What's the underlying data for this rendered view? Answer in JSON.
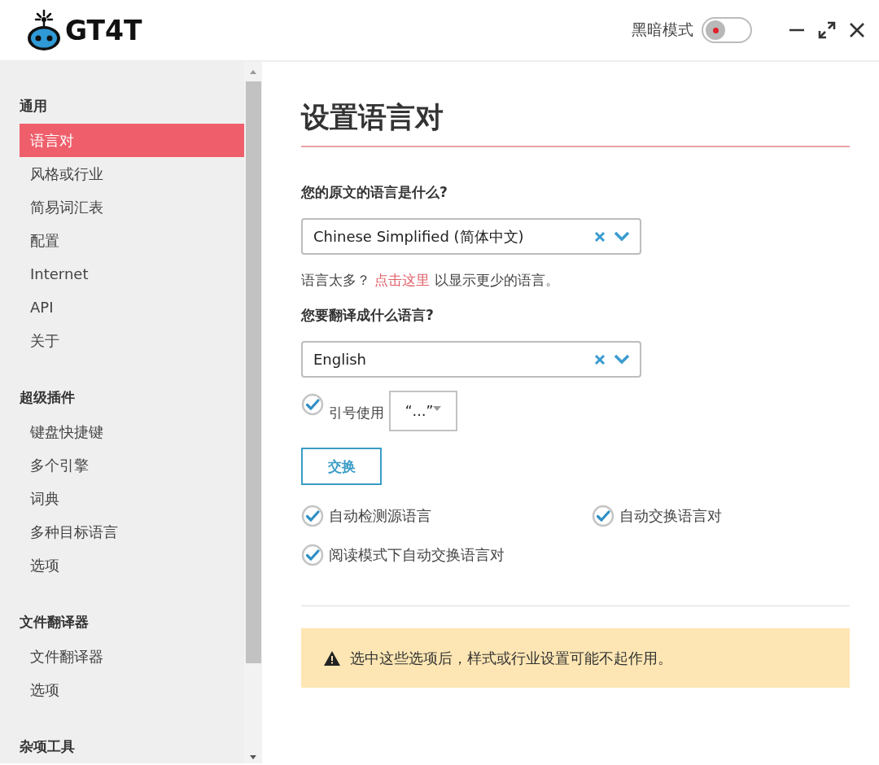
{
  "header": {
    "logo_text": "GT4T",
    "dark_mode": {
      "label": "黑暗模式",
      "on": false
    }
  },
  "sidebar": {
    "groups": [
      {
        "heading": "通用",
        "items": [
          {
            "label": "语言对",
            "selected": true
          },
          {
            "label": "风格或行业",
            "selected": false
          },
          {
            "label": "简易词汇表",
            "selected": false
          },
          {
            "label": "配置",
            "selected": false
          },
          {
            "label": "Internet",
            "selected": false
          },
          {
            "label": "API",
            "selected": false
          },
          {
            "label": "关于",
            "selected": false
          }
        ]
      },
      {
        "heading": "超级插件",
        "items": [
          {
            "label": "键盘快捷键",
            "selected": false
          },
          {
            "label": "多个引擎",
            "selected": false
          },
          {
            "label": "词典",
            "selected": false
          },
          {
            "label": "多种目标语言",
            "selected": false
          },
          {
            "label": "选项",
            "selected": false
          }
        ]
      },
      {
        "heading": "文件翻译器",
        "items": [
          {
            "label": "文件翻译器",
            "selected": false
          },
          {
            "label": "选项",
            "selected": false
          }
        ]
      },
      {
        "heading": "杂项工具"
      }
    ]
  },
  "main": {
    "title": "设置语言对",
    "source": {
      "question": "您的原文的语言是什么?",
      "value": "Chinese Simplified (简体中文)"
    },
    "hint": {
      "before": "语言太多？",
      "link": "点击这里",
      "after": "以显示更少的语言。"
    },
    "target": {
      "question": "您要翻译成什么语言?",
      "value": "English"
    },
    "quotes": {
      "label": "引号使用",
      "checked": true,
      "value": "“…”"
    },
    "swap_button": "交换",
    "options": [
      {
        "label": "自动检测源语言",
        "checked": true
      },
      {
        "label": "自动交换语言对",
        "checked": true
      },
      {
        "label": "阅读模式下自动交换语言对",
        "checked": true
      }
    ],
    "warning": "选中这些选项后，样式或行业设置可能不起作用。"
  }
}
